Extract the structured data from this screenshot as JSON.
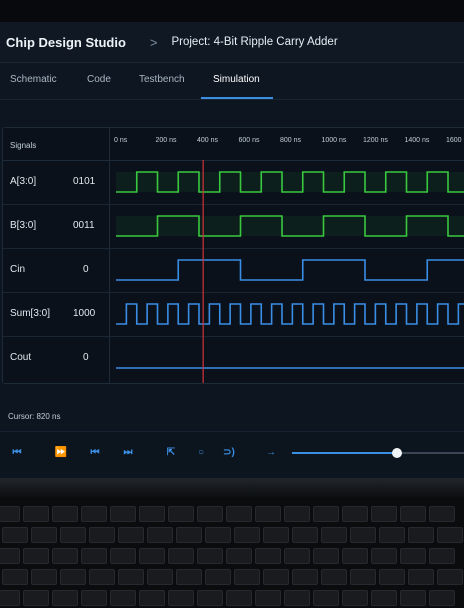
{
  "app": {
    "title": "Chip Design Studio",
    "separator": ">",
    "project": "Project: 4-Bit Ripple Carry Adder"
  },
  "tabs": [
    {
      "label": "Schematic",
      "active": false
    },
    {
      "label": "Code",
      "active": false
    },
    {
      "label": "Testbench",
      "active": false
    },
    {
      "label": "Simulation",
      "active": true
    }
  ],
  "waveform": {
    "signals_header": "Signals",
    "time_ticks": [
      "0 ns",
      "200 ns",
      "400 ns",
      "600 ns",
      "800 ns",
      "1000 ns",
      "1200 ns",
      "1400 ns",
      "1600 ns"
    ],
    "signals": [
      {
        "name": "A[3:0]",
        "value": "0101",
        "color": "#39c83f",
        "kind": "bus",
        "half_period_ns": 100
      },
      {
        "name": "B[3:0]",
        "value": "0011",
        "color": "#39c83f",
        "kind": "bus",
        "half_period_ns": 200
      },
      {
        "name": "Cin",
        "value": "0",
        "color": "#3a8ee6",
        "kind": "clock",
        "half_period_ns": 300
      },
      {
        "name": "Sum[3:0]",
        "value": "1000",
        "color": "#3a8ee6",
        "kind": "bus",
        "half_period_ns": 50
      },
      {
        "name": "Cout",
        "value": "0",
        "color": "#3a8ee6",
        "kind": "flat",
        "half_period_ns": 0
      }
    ],
    "cursor_ns": 420,
    "cursor_color": "#d0343a"
  },
  "status": {
    "cursor_readout": "Cursor: 820 ns"
  },
  "toolbar": {
    "buttons": [
      {
        "name": "step-back-icon",
        "glyph": "⏮"
      },
      {
        "name": "fast-forward-icon",
        "glyph": "⏩"
      },
      {
        "name": "skip-back-icon",
        "glyph": "⏮"
      },
      {
        "name": "skip-forward-icon",
        "glyph": "⏭"
      },
      {
        "name": "zoom-fit-icon",
        "glyph": "⇱"
      },
      {
        "name": "zoom-search-icon",
        "glyph": "○"
      },
      {
        "name": "zoom-in-icon",
        "glyph": "⊃)"
      },
      {
        "name": "go-to-cursor-icon",
        "glyph": "→"
      }
    ],
    "playback_position": 0.61
  }
}
